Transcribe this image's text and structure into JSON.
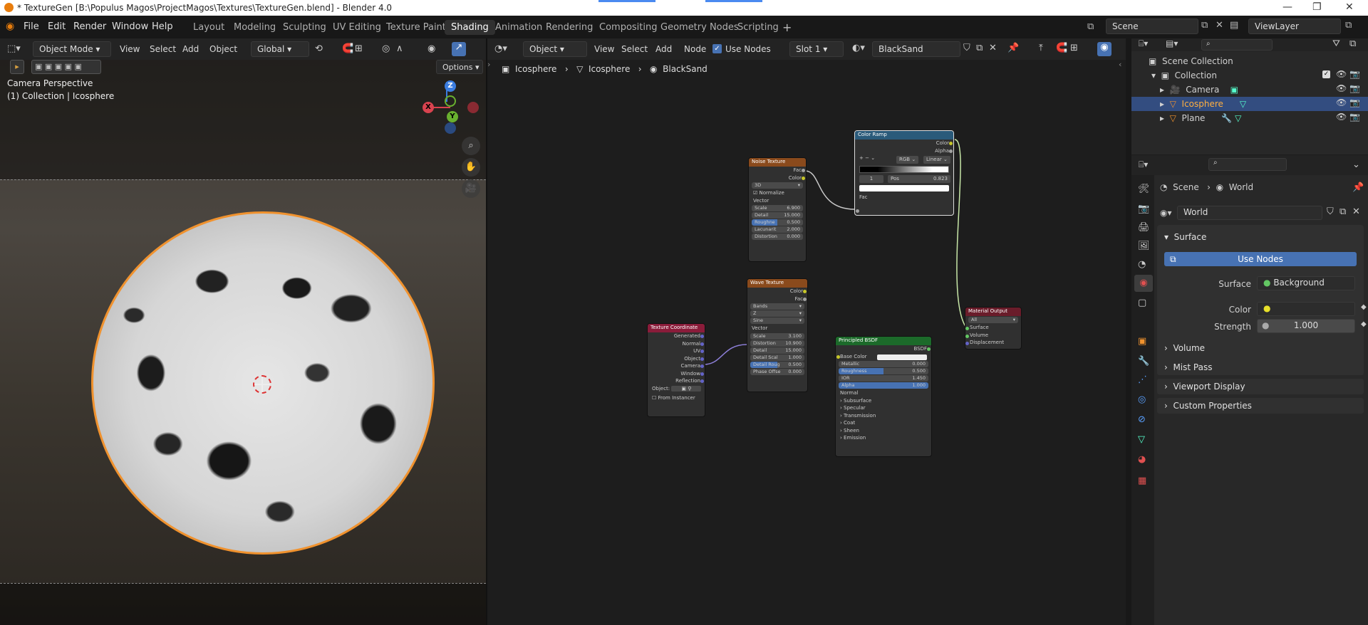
{
  "window": {
    "title": "* TextureGen [B:\\Populus Magos\\ProjectMagos\\Textures\\TextureGen.blend] - Blender 4.0"
  },
  "menu": [
    "File",
    "Edit",
    "Render",
    "Window",
    "Help"
  ],
  "workspaces": [
    "Layout",
    "Modeling",
    "Sculpting",
    "UV Editing",
    "Texture Paint",
    "Shading",
    "Animation",
    "Rendering",
    "Compositing",
    "Geometry Nodes",
    "Scripting"
  ],
  "active_workspace": "Shading",
  "scene": "Scene",
  "view_layer": "ViewLayer",
  "viewport": {
    "mode": "Object Mode",
    "menus": [
      "View",
      "Select",
      "Add",
      "Object"
    ],
    "transform": "Global",
    "options": "Options",
    "info_line1": "Camera Perspective",
    "info_line2": "(1) Collection | Icosphere",
    "gizmo": {
      "x": "X",
      "y": "Y",
      "z": "Z"
    }
  },
  "node_editor": {
    "type": "Object",
    "menus": [
      "View",
      "Select",
      "Add",
      "Node"
    ],
    "use_nodes": "Use Nodes",
    "slot": "Slot 1",
    "material": "BlackSand",
    "breadcrumb": [
      "Icosphere",
      "Icosphere",
      "BlackSand"
    ]
  },
  "nodes": {
    "noise": {
      "title": "Noise Texture",
      "outputs": [
        "Fac",
        "Color"
      ],
      "dim": "3D",
      "normalize": "Normalize",
      "vector": "Vector",
      "fields": [
        {
          "l": "Scale",
          "v": "6.900"
        },
        {
          "l": "Detail",
          "v": "15.000"
        },
        {
          "l": "Roughne",
          "v": "0.500"
        },
        {
          "l": "Lacunarit",
          "v": "2.000"
        },
        {
          "l": "Distortion",
          "v": "0.000"
        }
      ]
    },
    "ramp": {
      "title": "Color Ramp",
      "outputs": [
        "Color",
        "Alpha"
      ],
      "mode": "RGB",
      "interp": "Linear",
      "index": "1",
      "pos_label": "Pos",
      "pos": "0.823",
      "input": "Fac"
    },
    "wave": {
      "title": "Wave Texture",
      "outputs": [
        "Color",
        "Fac"
      ],
      "type": "Bands",
      "axis": "Z",
      "profile": "Sine",
      "vector": "Vector",
      "fields": [
        {
          "l": "Scale",
          "v": "3.100"
        },
        {
          "l": "Distortion",
          "v": "10.900"
        },
        {
          "l": "Detail",
          "v": "15.000"
        },
        {
          "l": "Detail Scal",
          "v": "1.000"
        },
        {
          "l": "Detail Roug",
          "v": "0.500"
        },
        {
          "l": "Phase Offse",
          "v": "0.000"
        }
      ]
    },
    "texcoord": {
      "title": "Texture Coordinate",
      "outputs": [
        "Generated",
        "Normal",
        "UV",
        "Object",
        "Camera",
        "Window",
        "Reflection"
      ],
      "object": "Object:",
      "from_instancer": "From Instancer"
    },
    "bsdf": {
      "title": "Principled BSDF",
      "output": "BSDF",
      "base_color": "Base Color",
      "fields": [
        {
          "l": "Metallic",
          "v": "0.000"
        },
        {
          "l": "Roughness",
          "v": "0.500"
        },
        {
          "l": "IOR",
          "v": "1.450"
        },
        {
          "l": "Alpha",
          "v": "1.000"
        }
      ],
      "normal": "Normal",
      "sections": [
        "Subsurface",
        "Specular",
        "Transmission",
        "Coat",
        "Sheen",
        "Emission"
      ]
    },
    "output": {
      "title": "Material Output",
      "target": "All",
      "inputs": [
        "Surface",
        "Volume",
        "Displacement"
      ]
    }
  },
  "outliner": {
    "root": "Scene Collection",
    "collection": "Collection",
    "items": [
      "Camera",
      "Icosphere",
      "Plane"
    ]
  },
  "properties": {
    "breadcrumb": [
      "Scene",
      "World"
    ],
    "world": "World",
    "surface_panel": "Surface",
    "use_nodes": "Use Nodes",
    "surface_label": "Surface",
    "surface_value": "Background",
    "color_label": "Color",
    "strength_label": "Strength",
    "strength": "1.000",
    "panels": [
      "Volume",
      "Mist Pass",
      "Viewport Display",
      "Custom Properties"
    ]
  },
  "colors": {
    "accent": "#4772b3",
    "selection": "#f0922e",
    "noise_header": "#8a4a1c",
    "ramp_header": "#2a5a7a",
    "texcoord_header": "#8a1c3a",
    "bsdf_header": "#1c6a2a",
    "output_header": "#6a1c2a"
  }
}
